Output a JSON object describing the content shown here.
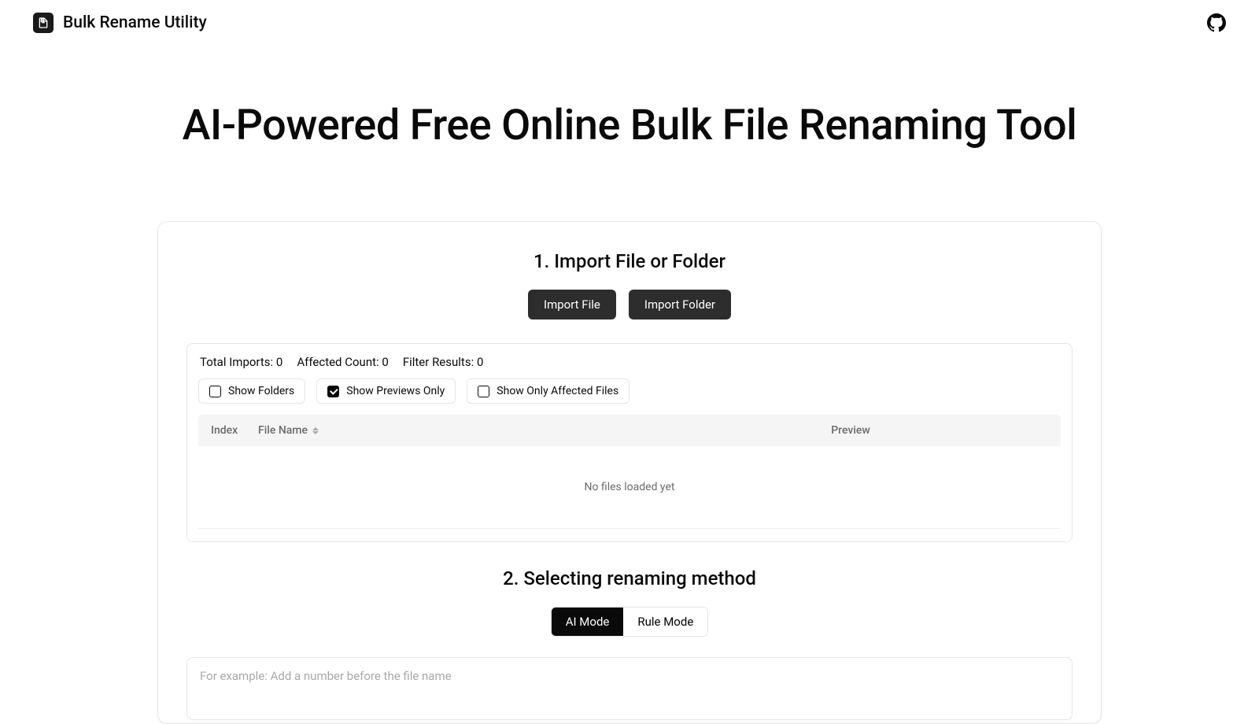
{
  "header": {
    "app_title": "Bulk Rename Utility"
  },
  "page_title": "AI-Powered Free Online Bulk File Renaming Tool",
  "section1": {
    "title": "1. Import File or Folder",
    "import_file_btn": "Import File",
    "import_folder_btn": "Import Folder",
    "stats": {
      "total_imports_label": "Total Imports:",
      "total_imports_value": "0",
      "affected_count_label": "Affected Count:",
      "affected_count_value": "0",
      "filter_results_label": "Filter Results:",
      "filter_results_value": "0"
    },
    "checkboxes": {
      "show_folders": "Show Folders",
      "show_previews_only": "Show Previews Only",
      "show_only_affected": "Show Only Affected Files"
    },
    "table": {
      "col_index": "Index",
      "col_filename": "File Name",
      "col_preview": "Preview",
      "empty_message": "No files loaded yet"
    }
  },
  "section2": {
    "title": "2. Selecting renaming method",
    "ai_mode_btn": "AI Mode",
    "rule_mode_btn": "Rule Mode",
    "textarea_placeholder": "For example: Add a number before the file name"
  }
}
